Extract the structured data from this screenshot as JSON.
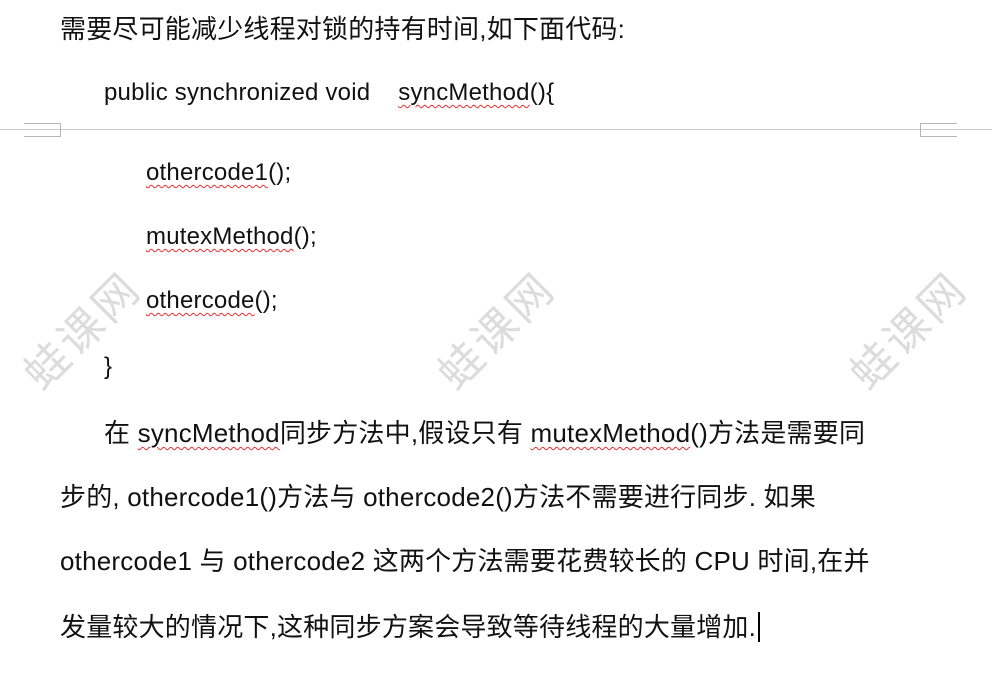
{
  "watermark": {
    "text": "蛙课网"
  },
  "doc": {
    "intro": "需要尽可能减少线程对锁的持有时间,如下面代码:",
    "code": {
      "signature_prefix": "public synchronized void",
      "method_name": "syncMethod",
      "signature_suffix": "(){",
      "line1_name": "othercode1",
      "line1_suffix": "();",
      "line2_name": "mutexMethod",
      "line2_suffix": "();",
      "line3_name": "othercode",
      "line3_suffix": "();",
      "closing": "}"
    },
    "para": {
      "s1": "在",
      "s2": "syncMethod",
      "s3": "同步方法中,假设只有",
      "s4": "mutexMethod",
      "s5": "()方法是需要同",
      "line2": "步的, othercode1()方法与 othercode2()方法不需要进行同步. 如果",
      "line3": "othercode1 与 othercode2 这两个方法需要花费较长的 CPU 时间,在并",
      "line4": "发量较大的情况下,这种同步方案会导致等待线程的大量增加."
    }
  }
}
